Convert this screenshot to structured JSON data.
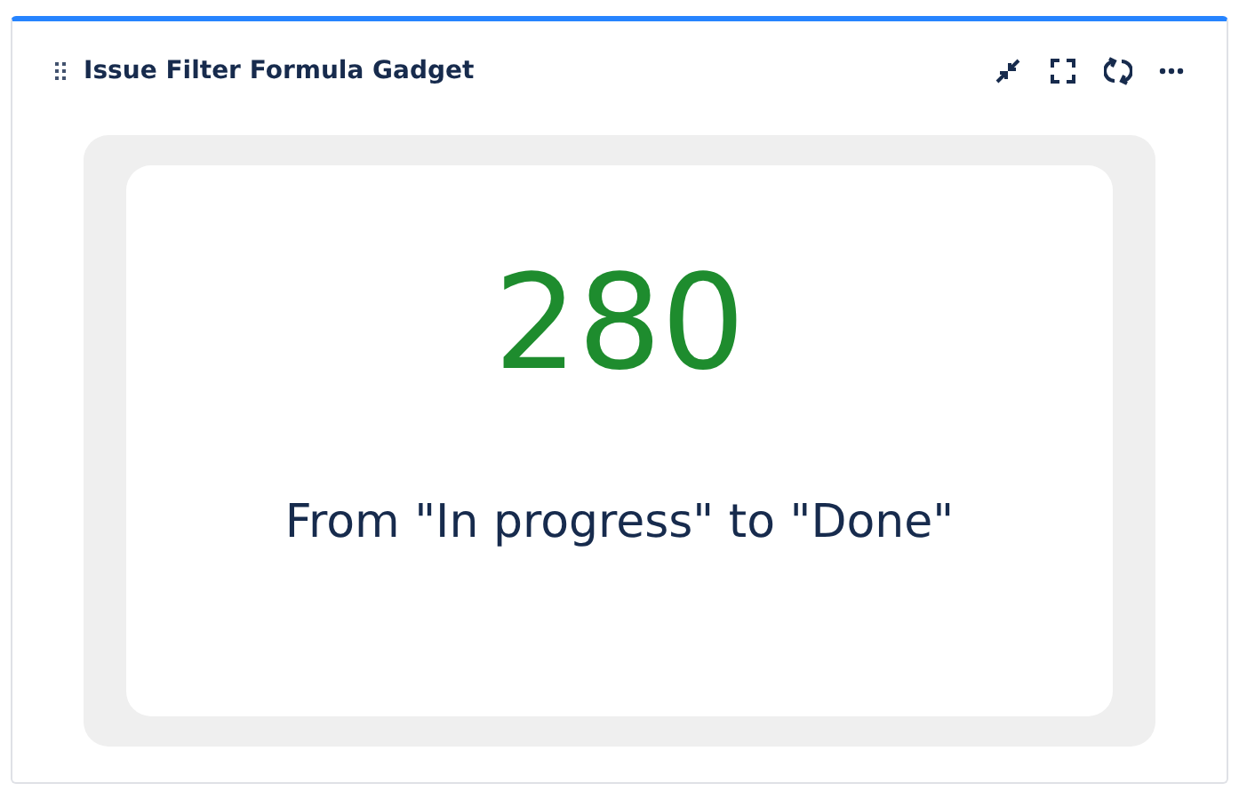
{
  "gadget": {
    "title": "Issue Filter Formula Gadget"
  },
  "result": {
    "value": "280",
    "caption": "From \"In progress\" to \"Done\""
  }
}
